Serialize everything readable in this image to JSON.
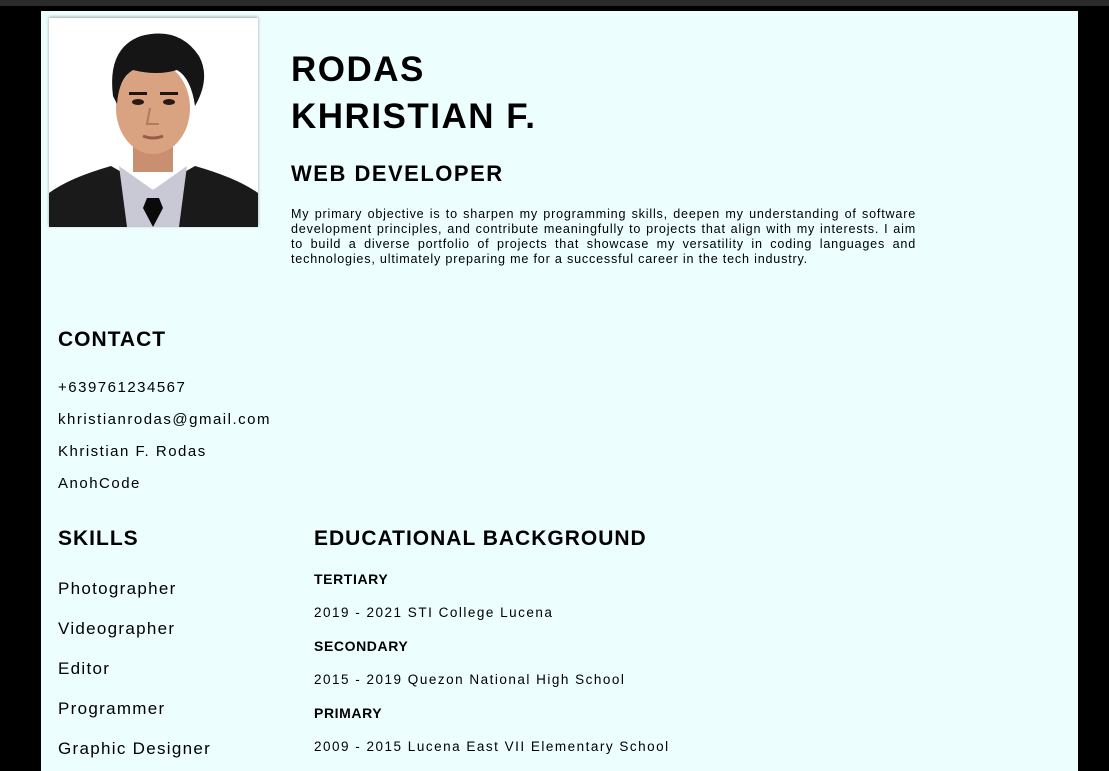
{
  "profile": {
    "last_name": "RODAS",
    "first_name": "KHRISTIAN F.",
    "role": "WEB DEVELOPER",
    "objective": "My primary objective is to sharpen my programming skills, deepen my understanding of software development principles, and contribute meaningfully to projects that align with my interests. I aim to build a diverse portfolio of projects that showcase my versatility in coding languages and technologies, ultimately preparing me for a successful career in the tech industry."
  },
  "contact": {
    "title": "CONTACT",
    "items": [
      "+639761234567",
      "khristianrodas@gmail.com",
      "Khristian F. Rodas",
      "AnohCode"
    ]
  },
  "skills": {
    "title": "SKILLS",
    "items": [
      "Photographer",
      "Videographer",
      "Editor",
      "Programmer",
      "Graphic Designer"
    ]
  },
  "education": {
    "title": "EDUCATIONAL BACKGROUND",
    "entries": [
      {
        "level": "TERTIARY",
        "detail": "2019 - 2021 STI College Lucena"
      },
      {
        "level": "SECONDARY",
        "detail": "2015 - 2019 Quezon National High School"
      },
      {
        "level": "PRIMARY",
        "detail": "2009 - 2015 Lucena East VII Elementary School"
      }
    ]
  },
  "colors": {
    "page_background": "#ecfefe",
    "outer_background": "#000000",
    "text": "#000000"
  }
}
